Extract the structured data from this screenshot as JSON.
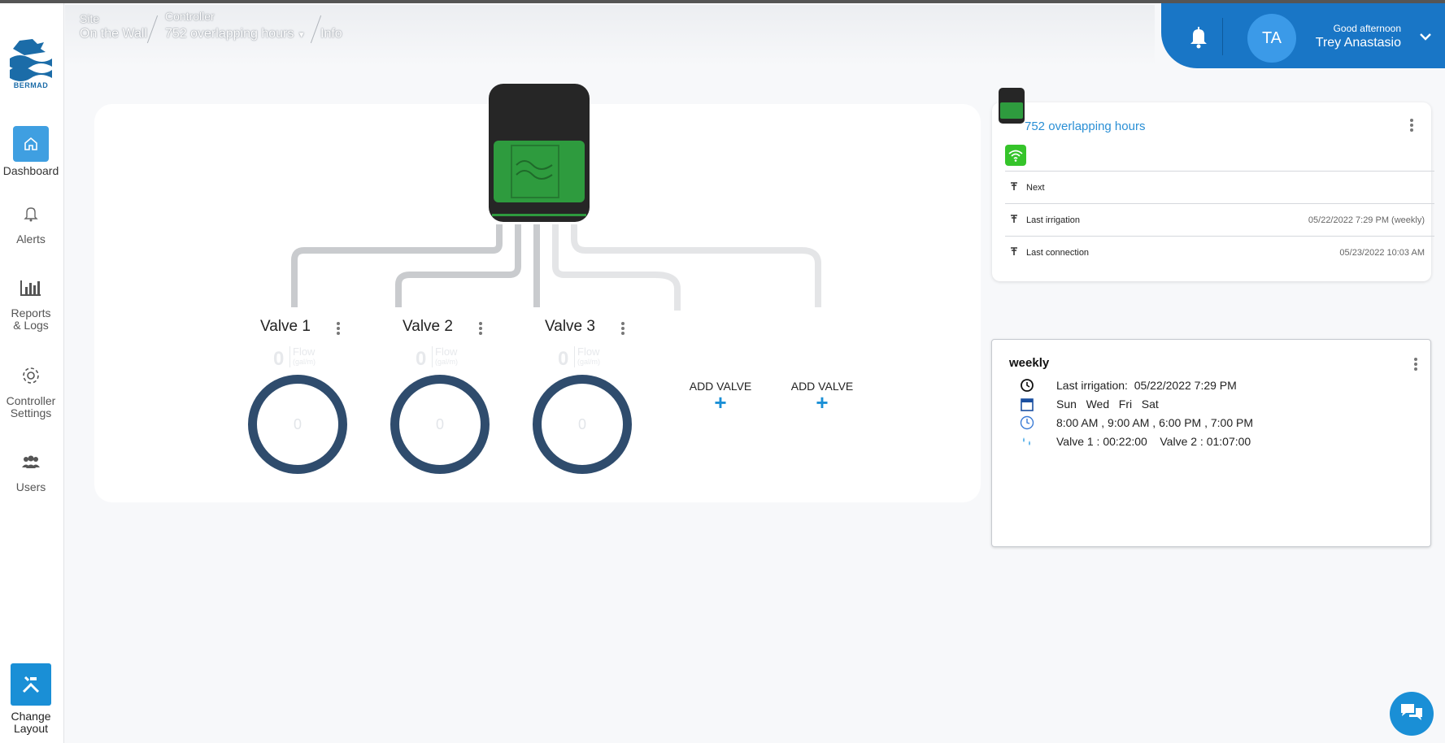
{
  "header": {
    "site_label": "Site",
    "site_value": "On the Wall",
    "controller_label": "Controller",
    "controller_value": "752 overlapping hours",
    "page": "Info"
  },
  "user": {
    "initials": "TA",
    "greeting": "Good afternoon",
    "name": "Trey Anastasio"
  },
  "sidebar": {
    "logo_text": "BERMAD",
    "items": [
      {
        "label": "Dashboard",
        "icon": "home-icon",
        "active": true
      },
      {
        "label": "Alerts",
        "icon": "bell-icon"
      },
      {
        "label": "Reports\n& Logs",
        "icon": "bar-chart-icon"
      },
      {
        "label": "Controller\nSettings",
        "icon": "gear-icon"
      },
      {
        "label": "Users",
        "icon": "users-icon"
      }
    ],
    "change_layout": "Change\nLayout"
  },
  "valves": [
    {
      "name": "Valve 1",
      "flow": "0",
      "flow_label": "Flow",
      "flow_unit": "(gal/m)",
      "gauge": "0"
    },
    {
      "name": "Valve 2",
      "flow": "0",
      "flow_label": "Flow",
      "flow_unit": "(gal/m)",
      "gauge": "0"
    },
    {
      "name": "Valve 3",
      "flow": "0",
      "flow_label": "Flow",
      "flow_unit": "(gal/m)",
      "gauge": "0"
    }
  ],
  "add_valve": [
    "ADD VALVE",
    "ADD VALVE"
  ],
  "add_valve_plus": "+",
  "controller_info": {
    "title": "752 overlapping hours",
    "rows": [
      {
        "label": "Next",
        "value": ""
      },
      {
        "label": "Last irrigation",
        "value": "05/22/2022 7:29 PM (weekly)"
      },
      {
        "label": "Last connection",
        "value": "05/23/2022 10:03 AM"
      }
    ]
  },
  "schedule": {
    "title": "weekly",
    "last_irrigation": "Last irrigation:  05/22/2022 7:29 PM",
    "days": "Sun   Wed   Fri   Sat",
    "times": "8:00 AM , 9:00 AM , 6:00 PM , 7:00 PM",
    "durations": "Valve 1 : 00:22:00    Valve 2 : 01:07:00"
  },
  "colors": {
    "accent": "#1976c6",
    "link": "#2a8fd5",
    "valve_ring": "#2f4c6d",
    "controller_green": "#2e9b3e",
    "wifi_green": "#35c42a"
  }
}
